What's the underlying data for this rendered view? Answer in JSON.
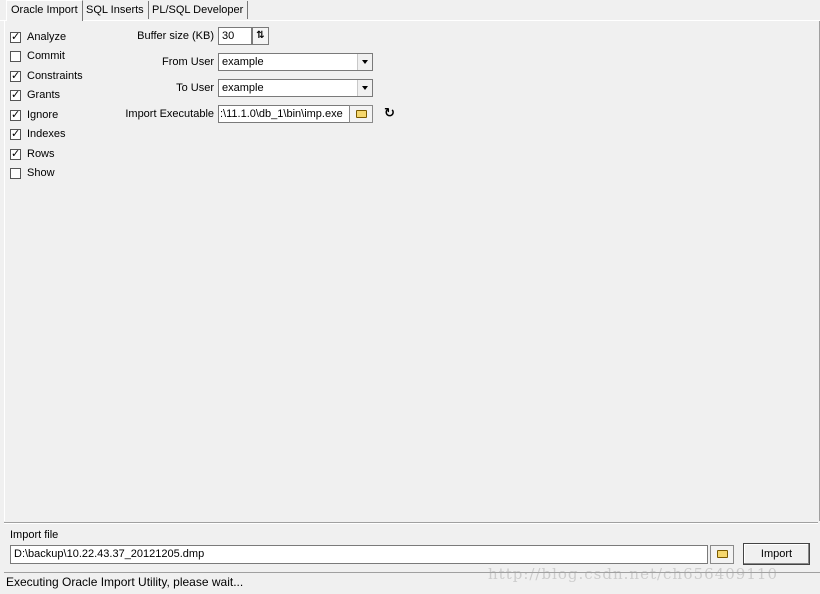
{
  "tabs": [
    {
      "label": "Oracle Import",
      "active": true
    },
    {
      "label": "SQL Inserts",
      "active": false
    },
    {
      "label": "PL/SQL Developer",
      "active": false
    }
  ],
  "options": [
    {
      "label": "Analyze",
      "checked": true
    },
    {
      "label": "Commit",
      "checked": false
    },
    {
      "label": "Constraints",
      "checked": true
    },
    {
      "label": "Grants",
      "checked": true
    },
    {
      "label": "Ignore",
      "checked": true
    },
    {
      "label": "Indexes",
      "checked": true
    },
    {
      "label": "Rows",
      "checked": true
    },
    {
      "label": "Show",
      "checked": false
    }
  ],
  "form": {
    "buffer_size_label": "Buffer size (KB)",
    "buffer_size_value": "30",
    "from_user_label": "From User",
    "from_user_value": "example",
    "to_user_label": "To User",
    "to_user_value": "example",
    "import_exe_label": "Import Executable",
    "import_exe_value": ":\\11.1.0\\db_1\\bin\\imp.exe"
  },
  "import_file": {
    "label": "Import file",
    "value": "D:\\backup\\10.22.43.37_20121205.dmp",
    "import_button": "Import"
  },
  "status": {
    "text": "Executing Oracle Import Utility, please wait..."
  },
  "watermark": "http://blog.csdn.net/ch656409110",
  "icons": {
    "browse": "folder-open-icon",
    "refresh": "refresh-icon",
    "spin": "spin-updown-icon"
  }
}
